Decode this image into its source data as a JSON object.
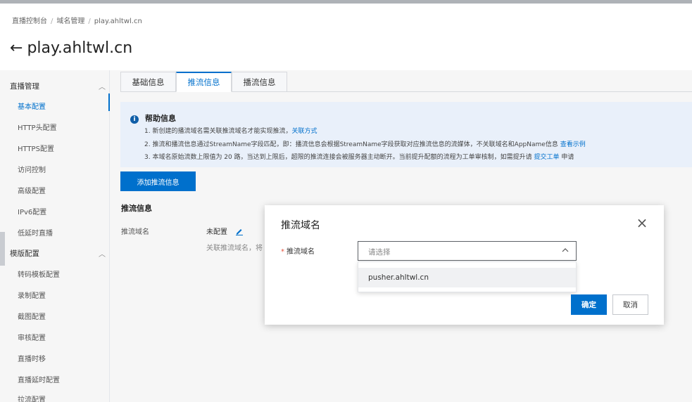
{
  "breadcrumb": [
    "直播控制台",
    "域名管理",
    "play.ahltwl.cn"
  ],
  "breadcrumb_sep": "/",
  "page": {
    "back_glyph": "←",
    "title": "play.ahltwl.cn"
  },
  "sidebar": {
    "group1": "直播管理",
    "group1_items": [
      "基本配置",
      "HTTP头配置",
      "HTTPS配置",
      "访问控制",
      "高级配置",
      "IPv6配置",
      "低延时直播"
    ],
    "group2": "模版配置",
    "group2_items": [
      "转码模板配置",
      "录制配置",
      "截图配置",
      "审核配置",
      "直播时移",
      "直播延时配置",
      "拉流配置"
    ],
    "active_item": "基本配置"
  },
  "tabs": [
    "基础信息",
    "推流信息",
    "播流信息"
  ],
  "active_tab": "推流信息",
  "help": {
    "title": "帮助信息",
    "line1": "1. 新创建的播流域名需关联推流域名才能实现推流，",
    "line1_link": "关联方式",
    "line2": "2. 推流和播流信息通过StreamName字段匹配，即：播流信息会根据StreamName字段获取对应推流信息的流媒体，不关联域名和AppName信息",
    "line2_link": "查看示例",
    "line3": "3. 本域名原始流数上限值为 20 路，当达到上限后，超限的推流连接会被服务器主动断开。当前提升配额的流程为工单审核制，如需提升请",
    "line3_link": "提交工单",
    "line3_tail": "申请"
  },
  "add_button": "添加推流信息",
  "section": {
    "title": "推流信息",
    "field_label": "推流域名",
    "field_value": "未配置",
    "hint": "关联推流域名，将"
  },
  "modal": {
    "title": "推流域名",
    "close": "×",
    "required_star": "*",
    "field_label": "推流域名",
    "placeholder": "请选择",
    "options": [
      "pusher.ahltwl.cn"
    ],
    "ok": "确定",
    "cancel": "取消"
  },
  "colors": {
    "primary": "#0070cc",
    "help_bg": "#e9f0fa",
    "required": "#e5533d"
  }
}
